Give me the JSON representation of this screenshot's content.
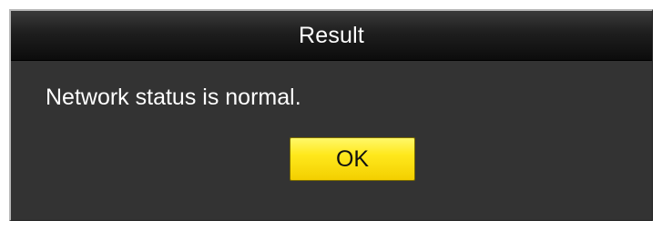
{
  "dialog": {
    "title": "Result",
    "message": "Network status is normal.",
    "ok_label": "OK"
  }
}
